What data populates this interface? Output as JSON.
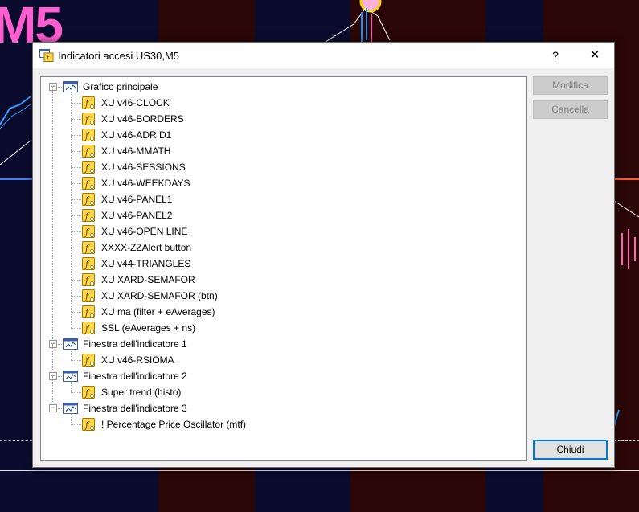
{
  "background": {
    "chart_label": "M5"
  },
  "dialog": {
    "title": "Indicatori accesi US30,M5",
    "help_label": "?",
    "close_label": "✕"
  },
  "tree": {
    "groups": [
      {
        "label": "Grafico principale",
        "items": [
          "XU v46-CLOCK",
          "XU v46-BORDERS",
          "XU v46-ADR D1",
          "XU v46-MMATH",
          "XU v46-SESSIONS",
          "XU v46-WEEKDAYS",
          "XU v46-PANEL1",
          "XU v46-PANEL2",
          "XU v46-OPEN LINE",
          "XXXX-ZZAlert button",
          "XU v44-TRIANGLES",
          "XU XARD-SEMAFOR",
          "XU XARD-SEMAFOR (btn)",
          "XU ma (filter + eAverages)",
          "SSL (eAverages + ns)"
        ]
      },
      {
        "label": "Finestra dell'indicatore 1",
        "items": [
          "XU v46-RSIOMA"
        ]
      },
      {
        "label": "Finestra dell'indicatore 2",
        "items": [
          "Super trend (histo)"
        ]
      },
      {
        "label": "Finestra dell'indicatore 3",
        "items": [
          "! Percentage Price Oscillator (mtf)"
        ]
      }
    ],
    "expander_symbol": "−"
  },
  "buttons": {
    "modify": "Modifica",
    "delete": "Cancella",
    "close": "Chiudi"
  }
}
